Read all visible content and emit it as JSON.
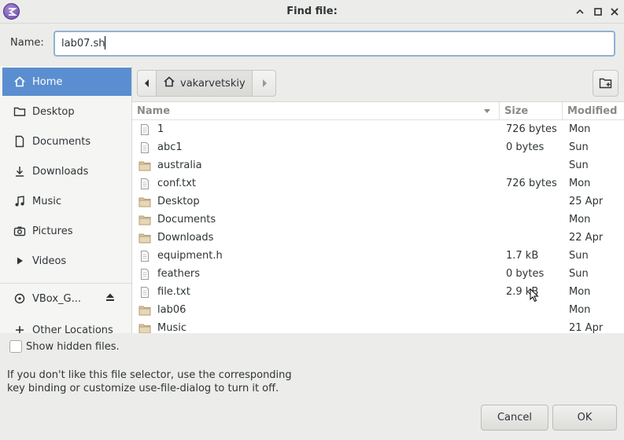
{
  "window": {
    "title": "Find file:"
  },
  "name_field": {
    "label": "Name:",
    "value": "lab07.sh"
  },
  "sidebar": {
    "items": [
      {
        "label": "Home",
        "icon": "home-icon",
        "selected": true
      },
      {
        "label": "Desktop",
        "icon": "folder-icon"
      },
      {
        "label": "Documents",
        "icon": "document-icon"
      },
      {
        "label": "Downloads",
        "icon": "download-icon"
      },
      {
        "label": "Music",
        "icon": "music-icon"
      },
      {
        "label": "Pictures",
        "icon": "camera-icon"
      },
      {
        "label": "Videos",
        "icon": "video-icon"
      },
      {
        "label": "VBox_G...",
        "icon": "disc-icon"
      },
      {
        "label": "Other Locations",
        "icon": "plus-icon"
      }
    ]
  },
  "pathbar": {
    "current": "vakarvetskiy"
  },
  "columns": {
    "name": "Name",
    "size": "Size",
    "modified": "Modified"
  },
  "files": [
    {
      "name": "1",
      "size": "726 bytes",
      "modified": "Mon",
      "type": "file"
    },
    {
      "name": "abc1",
      "size": "0 bytes",
      "modified": "Sun",
      "type": "file"
    },
    {
      "name": "australia",
      "size": "",
      "modified": "Sun",
      "type": "folder"
    },
    {
      "name": "conf.txt",
      "size": "726 bytes",
      "modified": "Mon",
      "type": "file"
    },
    {
      "name": "Desktop",
      "size": "",
      "modified": "25 Apr",
      "type": "folder"
    },
    {
      "name": "Documents",
      "size": "",
      "modified": "Mon",
      "type": "folder"
    },
    {
      "name": "Downloads",
      "size": "",
      "modified": "22 Apr",
      "type": "folder"
    },
    {
      "name": "equipment.h",
      "size": "1.7 kB",
      "modified": "Sun",
      "type": "file"
    },
    {
      "name": "feathers",
      "size": "0 bytes",
      "modified": "Sun",
      "type": "file"
    },
    {
      "name": "file.txt",
      "size": "2.9 kB",
      "modified": "Mon",
      "type": "file"
    },
    {
      "name": "lab06",
      "size": "",
      "modified": "Mon",
      "type": "folder"
    },
    {
      "name": "Music",
      "size": "",
      "modified": "21 Apr",
      "type": "folder"
    }
  ],
  "show_hidden": {
    "label": "Show hidden files.",
    "checked": false
  },
  "info": {
    "line1": "If you don't like this file selector, use the corresponding",
    "line2": "key binding or customize use-file-dialog to turn it off."
  },
  "buttons": {
    "cancel": "Cancel",
    "ok": "OK"
  },
  "colors": {
    "accent": "#5b8ed0",
    "focus_border": "#8fb1d4"
  }
}
